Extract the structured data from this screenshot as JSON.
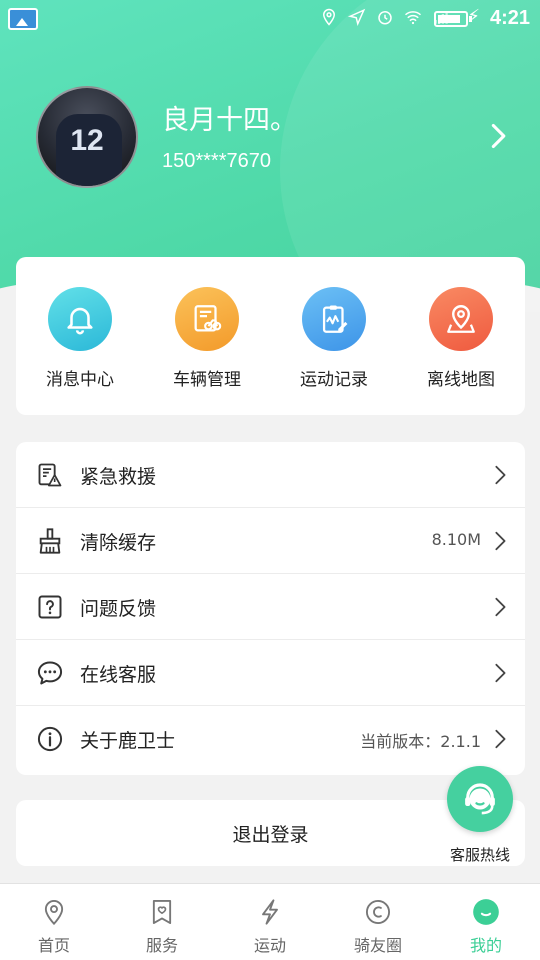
{
  "status_bar": {
    "time": "4:21",
    "icons": [
      "gallery-icon",
      "location-icon",
      "send-icon",
      "alarm-icon",
      "wifi-icon",
      "signal-icon",
      "battery-icon",
      "charging-icon"
    ]
  },
  "profile": {
    "name": "良月十四。",
    "phone": "150****7670",
    "avatar_jersey_number": "12"
  },
  "quick_actions": [
    {
      "label": "消息中心",
      "icon": "bell-icon",
      "color": "#34c7d6"
    },
    {
      "label": "车辆管理",
      "icon": "bike-manage-icon",
      "color": "#f7a93b"
    },
    {
      "label": "运动记录",
      "icon": "clipboard-chart-icon",
      "color": "#4aa8ef"
    },
    {
      "label": "离线地图",
      "icon": "map-pin-icon",
      "color": "#f46c50"
    }
  ],
  "menu": [
    {
      "label": "紧急救援",
      "icon": "emergency-icon",
      "value": ""
    },
    {
      "label": "清除缓存",
      "icon": "broom-icon",
      "value": "8.10M"
    },
    {
      "label": "问题反馈",
      "icon": "question-icon",
      "value": ""
    },
    {
      "label": "在线客服",
      "icon": "chat-icon",
      "value": ""
    },
    {
      "label": "关于鹿卫士",
      "icon": "info-icon",
      "value": "当前版本：2.1.1"
    }
  ],
  "logout_label": "退出登录",
  "hotline_label": "客服热线",
  "bottom_nav": [
    {
      "label": "首页",
      "icon": "location-pin-icon",
      "active": false
    },
    {
      "label": "服务",
      "icon": "bookmark-heart-icon",
      "active": false
    },
    {
      "label": "运动",
      "icon": "lightning-icon",
      "active": false
    },
    {
      "label": "骑友圈",
      "icon": "smile-icon",
      "active": false
    },
    {
      "label": "我的",
      "icon": "profile-smile-icon",
      "active": true
    }
  ],
  "colors": {
    "brand": "#4fd9a8",
    "active_nav": "#3ccf96",
    "background": "#f2f2f2"
  }
}
